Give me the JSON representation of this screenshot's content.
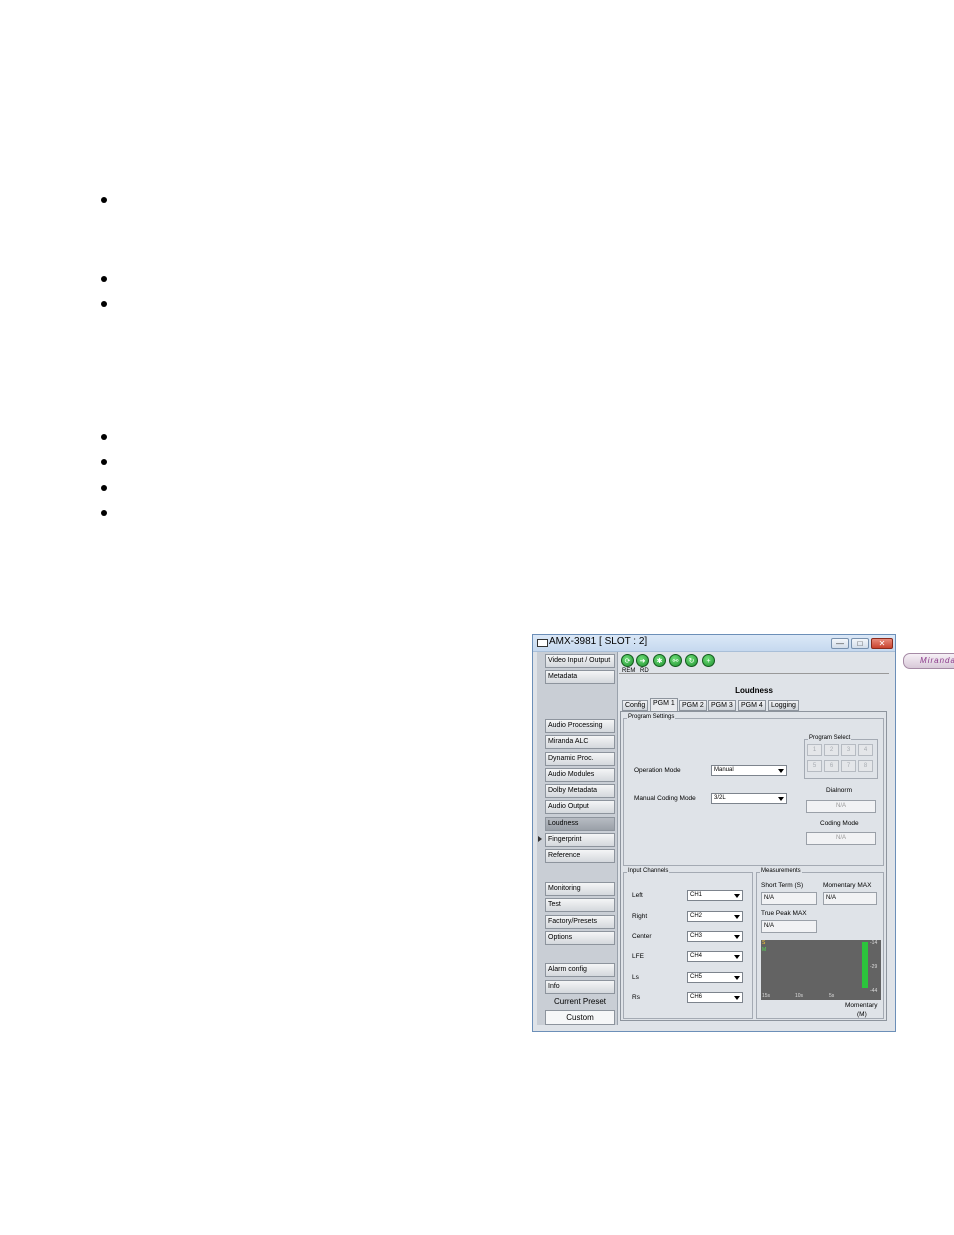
{
  "window": {
    "title": "AMX-3981 [ SLOT : 2]",
    "controls": {
      "minimize": "—",
      "maximize": "□",
      "close": "✕"
    }
  },
  "sidebar": {
    "items_top": [
      "Video Input / Output",
      "Metadata"
    ],
    "items_middle": [
      "Audio Processing",
      "Miranda ALC",
      "Dynamic Proc.",
      "Audio Modules",
      "Dolby Metadata",
      "Audio Output",
      "Loudness",
      "Fingerprint",
      "Reference"
    ],
    "items_bottom": [
      "Monitoring",
      "Test",
      "Factory/Presets",
      "Options"
    ],
    "items_last": [
      "Alarm config",
      "Info"
    ],
    "active": "Loudness",
    "current_preset_label": "Current Preset",
    "current_preset_value": "Custom"
  },
  "toolbar": {
    "icons": [
      "status-icon",
      "arrow-right-icon",
      "gear-icon",
      "network-icon",
      "refresh-icon",
      "add-icon"
    ],
    "labels": [
      "REM",
      "RD"
    ],
    "logo": "Miranda"
  },
  "main": {
    "heading": "Loudness",
    "tabs": [
      "Config",
      "PGM 1",
      "PGM 2",
      "PGM 3",
      "PGM 4",
      "Logging"
    ],
    "active_tab": "PGM 1"
  },
  "program_settings": {
    "title": "Program Settings",
    "operation_mode_label": "Operation Mode",
    "operation_mode_value": "Manual",
    "manual_coding_mode_label": "Manual Coding Mode",
    "manual_coding_mode_value": "3/2L",
    "program_select_title": "Program Select",
    "program_buttons": [
      "1",
      "2",
      "3",
      "4",
      "5",
      "6",
      "7",
      "8"
    ],
    "dialnorm_label": "Dialnorm",
    "dialnorm_value": "N/A",
    "coding_mode_label": "Coding Mode",
    "coding_mode_value": "N/A"
  },
  "input_channels": {
    "title": "Input Channels",
    "rows": [
      {
        "label": "Left",
        "value": "CH1"
      },
      {
        "label": "Right",
        "value": "CH2"
      },
      {
        "label": "Center",
        "value": "CH3"
      },
      {
        "label": "LFE",
        "value": "CH4"
      },
      {
        "label": "Ls",
        "value": "CH5"
      },
      {
        "label": "Rs",
        "value": "CH6"
      }
    ]
  },
  "measurements": {
    "title": "Measurements",
    "short_term_label": "Short Term (S)",
    "short_term_value": "N/A",
    "momentary_max_label": "Momentary MAX",
    "momentary_max_value": "N/A",
    "true_peak_label": "True Peak MAX",
    "true_peak_value": "N/A",
    "graph": {
      "legend_s": "S",
      "legend_m": "M",
      "y_ticks": [
        "-14",
        "-29",
        "-44"
      ],
      "x_ticks": [
        "15s",
        "10s",
        "5s"
      ],
      "footer_line1": "Momentary",
      "footer_line2": "(M)"
    }
  },
  "colors": {
    "accent_green": "#2cc43c",
    "logo_purple": "#8b3a8b",
    "graph_bg": "#636363"
  }
}
